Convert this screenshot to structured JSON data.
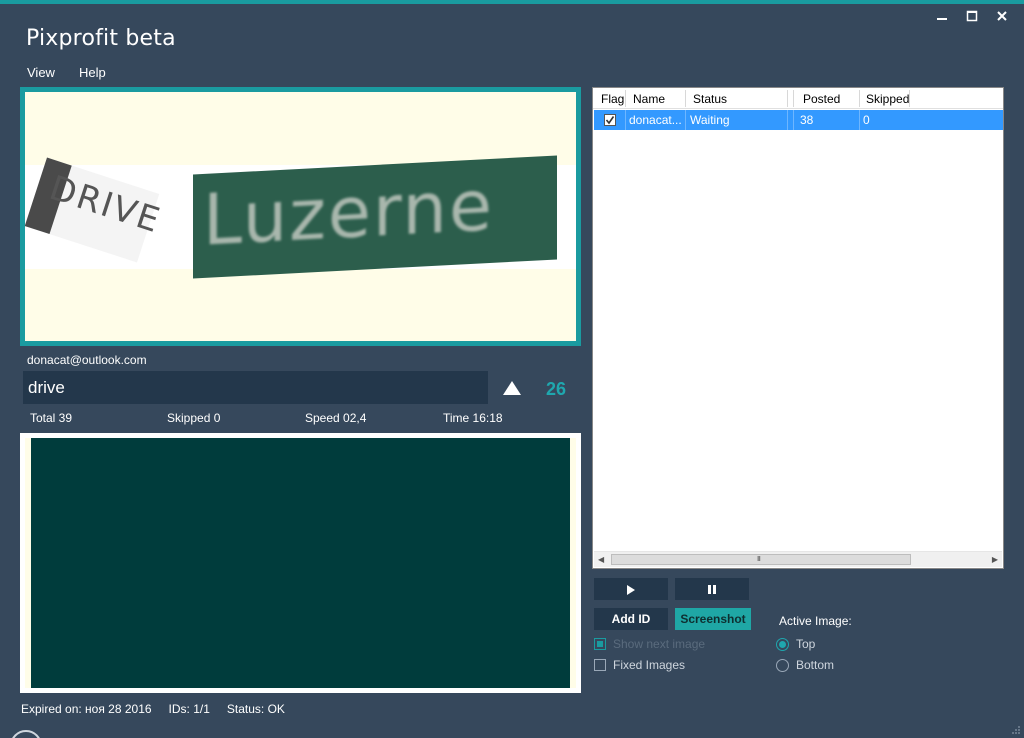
{
  "window": {
    "title": "Pixprofit beta",
    "controls": [
      "minimize-icon",
      "maximize-icon",
      "close-icon"
    ],
    "accent_color": "#1a9ba0"
  },
  "menu": {
    "view_label": "View",
    "help_label": "Help"
  },
  "captcha": {
    "words": [
      "DRIVE",
      "Luzerne"
    ]
  },
  "account": {
    "email": "donacat@outlook.com"
  },
  "answer": {
    "value": "drive",
    "counter": "26"
  },
  "stats": {
    "total": "Total 39",
    "skipped": "Skipped 0",
    "speed": "Speed 02,4",
    "time": "Time 16:18"
  },
  "footer": {
    "expired": "Expired on: ноя 28 2016",
    "ids": "IDs: 1/1",
    "status": "Status: OK"
  },
  "accounts_table": {
    "columns": [
      "Flag",
      "Name",
      "Status",
      "Posted",
      "Skipped"
    ],
    "rows": [
      {
        "flag": true,
        "name": "donacat...",
        "status": "Waiting",
        "posted": "38",
        "skipped": "0"
      }
    ],
    "scroll_grip": "III"
  },
  "controls": {
    "add_id_label": "Add ID",
    "screenshot_label": "Screenshot",
    "show_next_image_label": "Show next image",
    "show_next_image_checked": true,
    "fixed_images_label": "Fixed Images",
    "fixed_images_checked": false,
    "active_image_title": "Active Image:",
    "active_image_options": [
      "Top",
      "Bottom"
    ],
    "active_image_selected": "Top"
  }
}
